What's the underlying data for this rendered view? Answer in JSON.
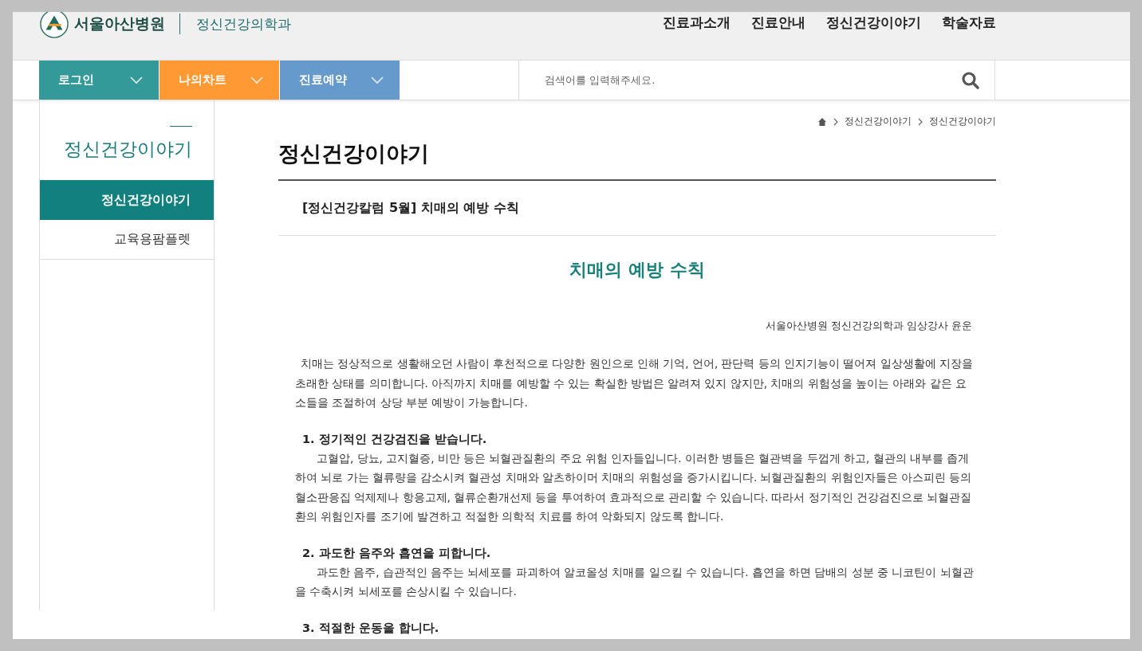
{
  "header": {
    "logo_text": "서울아산병원",
    "department": "정신건강의학과",
    "nav": [
      "진료과소개",
      "진료안내",
      "정신건강이야기",
      "학술자료"
    ]
  },
  "quick_buttons": [
    {
      "label": "로그인",
      "color": "#339a99"
    },
    {
      "label": "나의차트",
      "color": "#ff9933"
    },
    {
      "label": "진료예약",
      "color": "#6699cc"
    }
  ],
  "search": {
    "placeholder": "검색어를 입력해주세요."
  },
  "breadcrumb": [
    "정신건강이야기",
    "정신건강이야기"
  ],
  "sidebar": {
    "title": "정신건강이야기",
    "items": [
      {
        "label": "정신건강이야기",
        "selected": true
      },
      {
        "label": "교육용팜플렛",
        "selected": false
      }
    ]
  },
  "page_title": "정신건강이야기",
  "post_title": "[정신건강칼럼 5월] 치매의 예방 수칙",
  "article": {
    "title": "치매의 예방 수칙",
    "author": "서울아산병원 정신건강의학과 임상강사 윤운",
    "intro": "치매는 정상적으로 생활해오던 사람이 후천적으로 다양한 원인으로 인해 기억, 언어, 판단력 등의 인지기능이 떨어져 일상생활에 지장을 초래한 상태를 의미합니다. 아직까지 치매를 예방할 수 있는 확실한 방법은 알려져 있지 않지만, 치매의 위험성을 높이는 아래와 같은 요소들을 조절하여 상당 부분 예방이 가능합니다.",
    "sections": [
      {
        "heading": "1. 정기적인 건강검진을 받습니다.",
        "body": "고혈압, 당뇨, 고지혈증, 비만 등은 뇌혈관질환의 주요 위험 인자들입니다. 이러한 병들은 혈관벽을 두껍게 하고, 혈관의 내부를 좁게 하여 뇌로 가는 혈류량을 감소시켜 혈관성 치매와 알츠하이머 치매의 위험성을 증가시킵니다. 뇌혈관질환의 위험인자들은 아스피린 등의 혈소판응집 억제제나 항응고제, 혈류순환개선제 등을 투여하여 효과적으로 관리할 수 있습니다. 따라서 정기적인 건강검진으로 뇌혈관질환의 위험인자를 조기에 발견하고 적절한 의학적 치료를 하여 악화되지 않도록 합니다."
      },
      {
        "heading": "2. 과도한 음주와 흡연을 피합니다.",
        "body": "과도한 음주, 습관적인 음주는 뇌세포를 파괴하여 알코올성 치매를 일으킬 수 있습니다. 흡연을 하면 담배의 성분 중 니코틴이 뇌혈관을 수축시켜 뇌세포를 손상시킬 수 있습니다."
      },
      {
        "heading": "3. 적절한 운동을 합니다."
      }
    ]
  }
}
